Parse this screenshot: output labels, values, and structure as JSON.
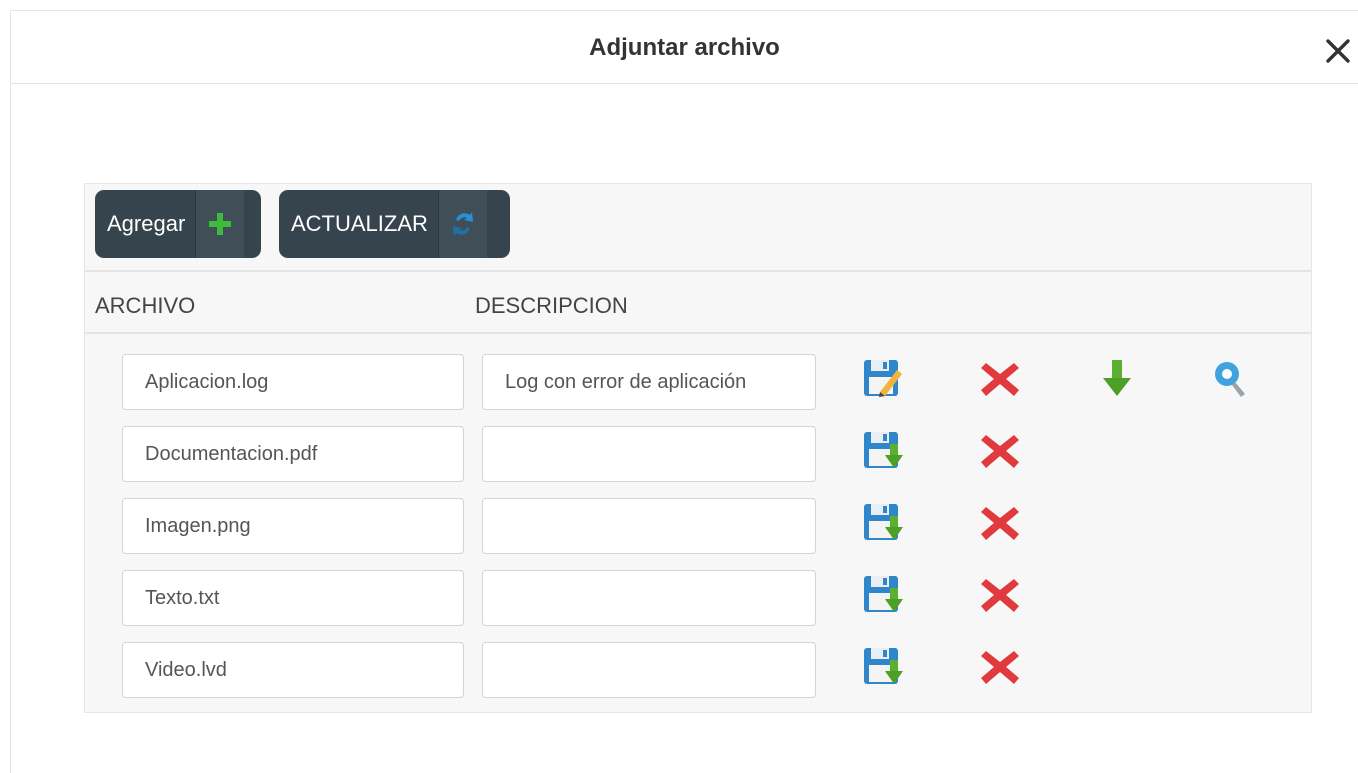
{
  "dialog": {
    "title": "Adjuntar archivo"
  },
  "toolbar": {
    "add_label": "Agregar",
    "refresh_label": "ACTUALIZAR"
  },
  "columns": {
    "file": "ARCHIVO",
    "description": "DESCRIPCION"
  },
  "rows": [
    {
      "file": "Aplicacion.log",
      "description": "Log con error de aplicación",
      "save_icon": "save-edit-icon",
      "actions": [
        "save-edit-icon",
        "delete-icon",
        "download-icon",
        "view-icon"
      ]
    },
    {
      "file": "Documentacion.pdf",
      "description": "",
      "save_icon": "save-download-icon",
      "actions": [
        "save-download-icon",
        "delete-icon"
      ]
    },
    {
      "file": "Imagen.png",
      "description": "",
      "save_icon": "save-download-icon",
      "actions": [
        "save-download-icon",
        "delete-icon"
      ]
    },
    {
      "file": "Texto.txt",
      "description": "",
      "save_icon": "save-download-icon",
      "actions": [
        "save-download-icon",
        "delete-icon"
      ]
    },
    {
      "file": "Video.lvd",
      "description": "",
      "save_icon": "save-download-icon",
      "actions": [
        "save-download-icon",
        "delete-icon"
      ]
    }
  ],
  "colors": {
    "button_bg": "#36444d",
    "add_icon": "#3dbb3d",
    "delete_icon": "#e0393e",
    "download_icon": "#5bb12f",
    "refresh_icon": "#2a8fd6"
  }
}
